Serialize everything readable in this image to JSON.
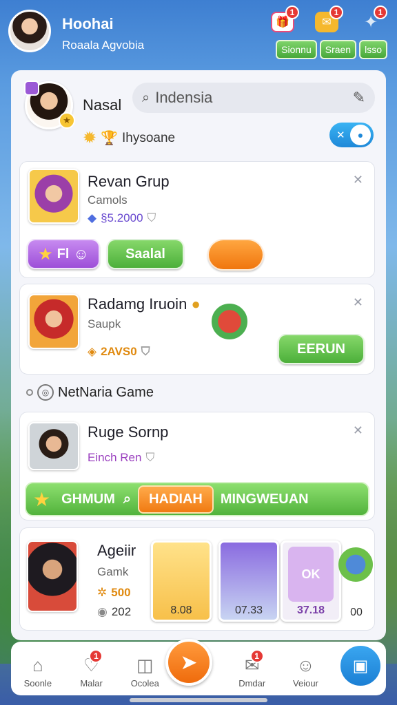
{
  "header": {
    "name": "Hoohai",
    "subtitle": "Roaala Agvobia",
    "icons": [
      {
        "name": "gift-icon",
        "badge": "1",
        "color": "#e84b7a"
      },
      {
        "name": "chat-icon",
        "badge": "1",
        "color": "#f5b82e"
      },
      {
        "name": "friends-icon",
        "badge": "1",
        "color": "#8fc4f2"
      }
    ],
    "pills": [
      "Sionnu",
      "Sraen",
      "lsso"
    ]
  },
  "me": {
    "name": "Nasal",
    "search_value": "Indensia",
    "status": "Ihysoane",
    "toggle_label": "✕"
  },
  "groups": [
    {
      "title": "Revan Grup",
      "sub": "Camols",
      "meta": "§5.2000",
      "buttons": {
        "purple": "Fl",
        "green": "Saalal",
        "orange": ""
      }
    },
    {
      "title": "Radamg Iruoin",
      "sub": "Saupk",
      "meta": "2AVS0",
      "button": "EERUN"
    }
  ],
  "section": {
    "title": "NetNaria Game"
  },
  "player": {
    "title": "Ruge Sornp",
    "sub": "Einch Ren"
  },
  "banner": {
    "left": "GHMUM",
    "center": "HADIAH",
    "right": "MINGWEUAN"
  },
  "bottom_cards": {
    "title": "Ageiir",
    "sub": "Gamk",
    "score": "500",
    "count": "202",
    "cards": [
      "8.08",
      "07.33",
      "OK",
      "00"
    ],
    "card_label": "37.18"
  },
  "tabs": [
    {
      "label": "Soonle",
      "icon": "home-icon"
    },
    {
      "label": "Malar",
      "icon": "heart-icon",
      "badge": "1"
    },
    {
      "label": "Ocolea",
      "icon": "camera-icon"
    },
    {
      "label": "Dmdar",
      "icon": "chat-bubble-icon",
      "badge": "1"
    },
    {
      "label": "Veiour",
      "icon": "user-icon"
    }
  ]
}
